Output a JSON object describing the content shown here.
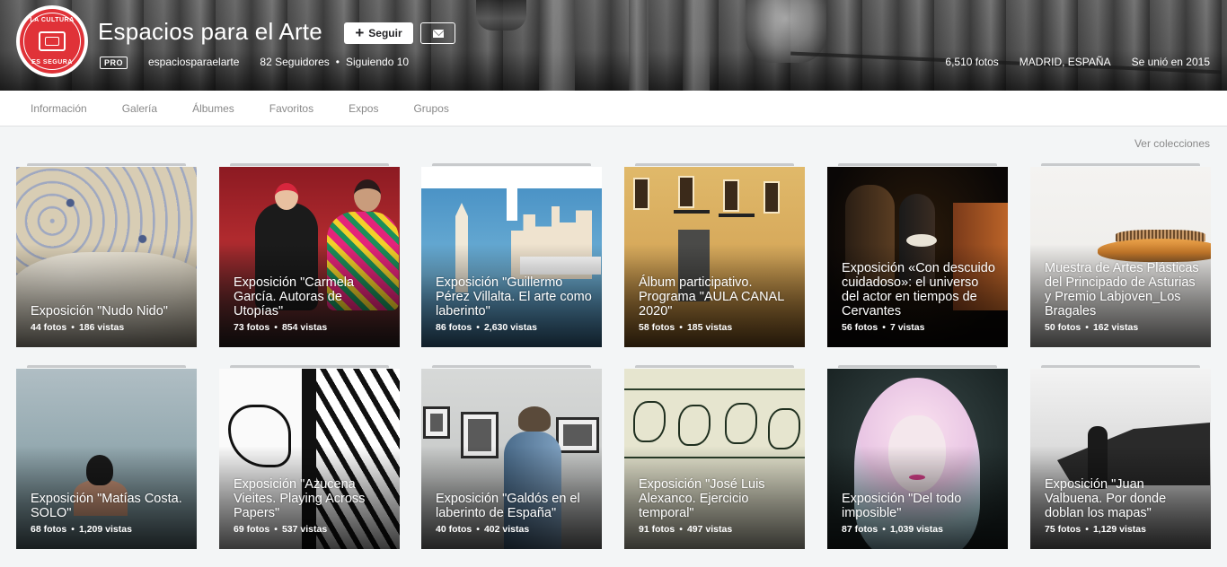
{
  "profile": {
    "avatar_text_top": "LA CULTURA",
    "avatar_text_bottom": "ES SEGURA",
    "name": "Espacios para el Arte",
    "follow_label": "Seguir",
    "pro_badge": "PRO",
    "username": "espaciosparaelarte",
    "followers": "82 Seguidores",
    "following": "Siguiendo 10",
    "photos_count": "6,510 fotos",
    "location": "MADRID, ESPAÑA",
    "joined": "Se unió en 2015"
  },
  "nav": {
    "items": [
      "Información",
      "Galería",
      "Álbumes",
      "Favoritos",
      "Expos",
      "Grupos"
    ]
  },
  "collections_link": "Ver colecciones",
  "albums": [
    {
      "title": "Exposición \"Nudo Nido\"",
      "photos": "44 fotos",
      "views": "186 vistas"
    },
    {
      "title": "Exposición \"Carmela García. Autoras de Utopías\"",
      "photos": "73 fotos",
      "views": "854 vistas"
    },
    {
      "title": "Exposición \"Guillermo Pérez Villalta. El arte como laberinto\"",
      "photos": "86 fotos",
      "views": "2,630 vistas"
    },
    {
      "title": "Álbum participativo. Programa \"AULA CANAL 2020\"",
      "photos": "58 fotos",
      "views": "185 vistas"
    },
    {
      "title": "Exposición «Con descuido cuidadoso»: el universo del actor en tiempos de Cervantes",
      "photos": "56 fotos",
      "views": "7 vistas"
    },
    {
      "title": "Muestra de Artes Plásticas del Principado de Asturias y Premio Labjoven_Los Bragales",
      "photos": "50 fotos",
      "views": "162 vistas"
    },
    {
      "title": "Exposición \"Matías Costa. SOLO\"",
      "photos": "68 fotos",
      "views": "1,209 vistas"
    },
    {
      "title": "Exposición \"Azucena Vieites. Playing Across Papers\"",
      "photos": "69 fotos",
      "views": "537 vistas"
    },
    {
      "title": "Exposición \"Galdós en el laberinto de España\"",
      "photos": "40 fotos",
      "views": "402 vistas"
    },
    {
      "title": "Exposición \"José Luis Alexanco. Ejercicio temporal\"",
      "photos": "91 fotos",
      "views": "497 vistas"
    },
    {
      "title": "Exposición \"Del todo imposible\"",
      "photos": "87 fotos",
      "views": "1,039 vistas"
    },
    {
      "title": "Exposición \"Juan Valbuena. Por donde doblan los mapas\"",
      "photos": "75 fotos",
      "views": "1,129 vistas"
    }
  ],
  "icons": {
    "follow": "plus-icon",
    "message": "envelope-icon"
  },
  "colors": {
    "avatar_red": "#e03238",
    "nav_text": "#898989",
    "page_bg": "#f3f5f6"
  }
}
